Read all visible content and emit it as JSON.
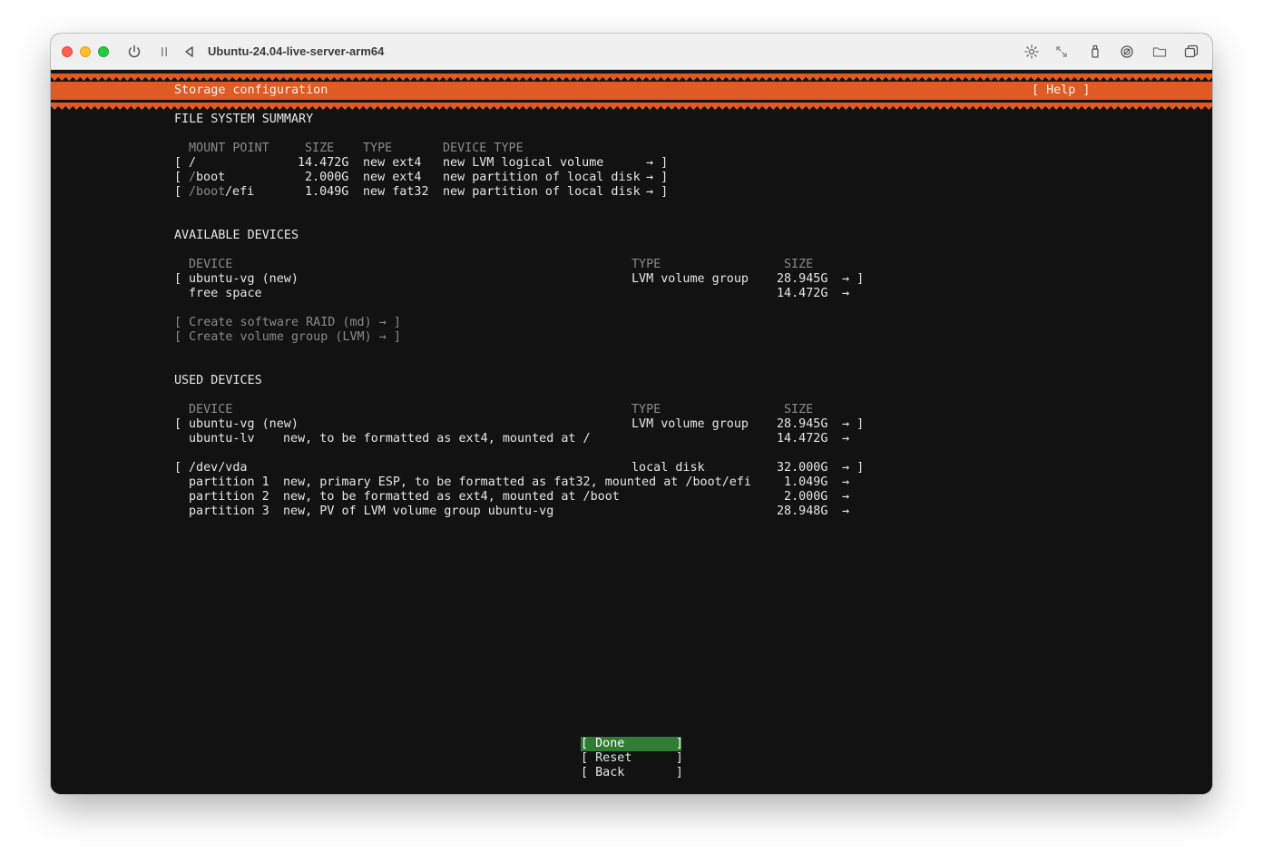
{
  "window": {
    "title": "Ubuntu-24.04-live-server-arm64"
  },
  "header": {
    "title": "Storage configuration",
    "help": "[ Help ]"
  },
  "fs_summary": {
    "heading": "FILE SYSTEM SUMMARY",
    "col_mount": "MOUNT POINT",
    "col_size": "SIZE",
    "col_type": "TYPE",
    "col_device_type": "DEVICE TYPE",
    "rows": [
      {
        "bracket": "[",
        "mount_a": "",
        "mount_b": "/",
        "size": "14.472G",
        "type": "new ext4",
        "device_type": "new LVM logical volume",
        "arrow": "→ ]"
      },
      {
        "bracket": "[",
        "mount_a": "/",
        "mount_b": "boot",
        "size": "2.000G",
        "type": "new ext4",
        "device_type": "new partition of local disk",
        "arrow": "→ ]"
      },
      {
        "bracket": "[",
        "mount_a": "/boot",
        "mount_b": "/efi",
        "size": "1.049G",
        "type": "new fat32",
        "device_type": "new partition of local disk",
        "arrow": "→ ]"
      }
    ]
  },
  "available": {
    "heading": "AVAILABLE DEVICES",
    "col_device": "DEVICE",
    "col_type": "TYPE",
    "col_size": "SIZE",
    "vg": {
      "bracket": "[",
      "name": "ubuntu-vg (new)",
      "type": "LVM volume group",
      "size": "28.945G",
      "arrow": "→ ]"
    },
    "free": {
      "name": "free space",
      "size": "14.472G",
      "arrow": "→"
    },
    "raid": "[ Create software RAID (md) → ]",
    "lvm": "[ Create volume group (LVM) → ]"
  },
  "used": {
    "heading": "USED DEVICES",
    "col_device": "DEVICE",
    "col_type": "TYPE",
    "col_size": "SIZE",
    "vg": {
      "bracket": "[",
      "name": "ubuntu-vg (new)",
      "type": "LVM volume group",
      "size": "28.945G",
      "arrow": "→ ]"
    },
    "lv": {
      "name": "ubuntu-lv",
      "desc": "new, to be formatted as ext4, mounted at /",
      "size": "14.472G",
      "arrow": "→"
    },
    "disk": {
      "bracket": "[",
      "name": "/dev/vda",
      "type": "local disk",
      "size": "32.000G",
      "arrow": "→ ]"
    },
    "parts": [
      {
        "name": "partition 1",
        "desc": "new, primary ESP, to be formatted as fat32, mounted at /boot/efi",
        "size": "1.049G",
        "arrow": "→"
      },
      {
        "name": "partition 2",
        "desc": "new, to be formatted as ext4, mounted at /boot",
        "size": "2.000G",
        "arrow": "→"
      },
      {
        "name": "partition 3",
        "desc": "new, PV of LVM volume group ubuntu-vg",
        "size": "28.948G",
        "arrow": "→"
      }
    ]
  },
  "buttons": {
    "done": "[ Done       ]",
    "reset": "[ Reset      ]",
    "back": "[ Back       ]"
  },
  "icons": {
    "power": "power-icon",
    "pause": "pause-icon",
    "back": "back-triangle-icon",
    "brightness": "brightness-icon",
    "resize": "resize-icon",
    "usb": "usb-icon",
    "audio": "audio-icon",
    "folder": "folder-icon",
    "windows": "windows-icon"
  }
}
